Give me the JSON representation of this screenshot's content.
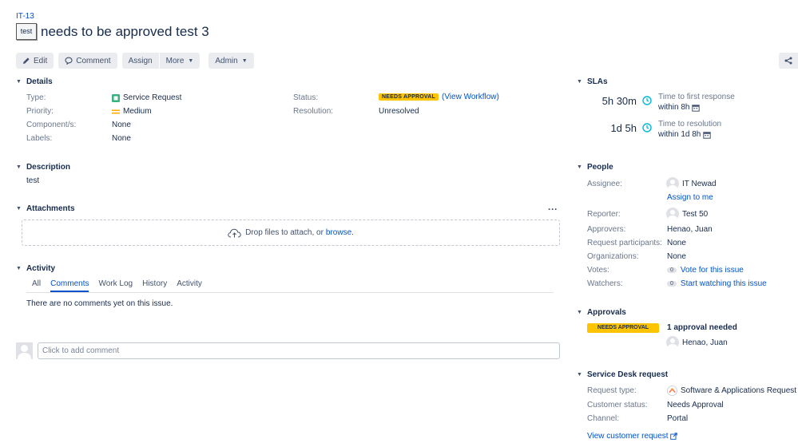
{
  "issue": {
    "key": "IT-13",
    "type_icon_label": "test",
    "title": "needs to be approved test 3"
  },
  "toolbar": {
    "edit": "Edit",
    "comment": "Comment",
    "assign": "Assign",
    "more": "More",
    "admin": "Admin"
  },
  "details": {
    "heading": "Details",
    "type_label": "Type:",
    "type_value": "Service Request",
    "priority_label": "Priority:",
    "priority_value": "Medium",
    "components_label": "Component/s:",
    "components_value": "None",
    "labels_label": "Labels:",
    "labels_value": "None",
    "status_label": "Status:",
    "status_value": "NEEDS APPROVAL",
    "view_workflow": "(View Workflow)",
    "resolution_label": "Resolution:",
    "resolution_value": "Unresolved"
  },
  "description": {
    "heading": "Description",
    "text": "test"
  },
  "attachments": {
    "heading": "Attachments",
    "more": "···",
    "drop_text": "Drop files to attach, or",
    "browse": "browse."
  },
  "activity": {
    "heading": "Activity",
    "tabs": [
      "All",
      "Comments",
      "Work Log",
      "History",
      "Activity"
    ],
    "empty": "There are no comments yet on this issue.",
    "comment_placeholder": "Click to add comment"
  },
  "slas": {
    "heading": "SLAs",
    "items": [
      {
        "time": "5h 30m",
        "name": "Time to first response",
        "within": "within 8h"
      },
      {
        "time": "1d 5h",
        "name": "Time to resolution",
        "within": "within 1d 8h"
      }
    ]
  },
  "people": {
    "heading": "People",
    "assignee_label": "Assignee:",
    "assignee_value": "IT Newad",
    "assign_to_me": "Assign to me",
    "reporter_label": "Reporter:",
    "reporter_value": "Test 50",
    "approvers_label": "Approvers:",
    "approvers_value": "Henao, Juan",
    "participants_label": "Request participants:",
    "participants_value": "None",
    "organizations_label": "Organizations:",
    "organizations_value": "None",
    "votes_label": "Votes:",
    "votes_count": "0",
    "votes_link": "Vote for this issue",
    "watchers_label": "Watchers:",
    "watchers_count": "0",
    "watchers_link": "Start watching this issue"
  },
  "approvals": {
    "heading": "Approvals",
    "status": "NEEDS APPROVAL",
    "needed": "1 approval needed",
    "approver": "Henao, Juan"
  },
  "service_desk": {
    "heading": "Service Desk request",
    "request_type_label": "Request type:",
    "request_type_value": "Software & Applications Request",
    "customer_status_label": "Customer status:",
    "customer_status_value": "Needs Approval",
    "channel_label": "Channel:",
    "channel_value": "Portal",
    "view_request": "View customer request"
  },
  "colors": {
    "link": "#0052cc",
    "lozenge": "#ffc400",
    "medium_priority": "#ffab00",
    "service_request_icon": "#36b37e",
    "sla_clock": "#00b8d9"
  }
}
